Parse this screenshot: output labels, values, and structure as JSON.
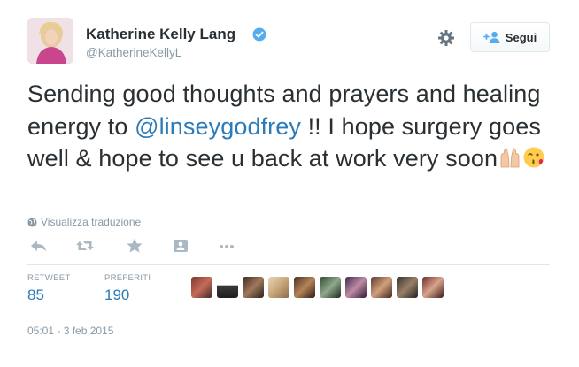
{
  "author": {
    "name": "Katherine Kelly Lang",
    "handle": "@KatherineKellyL",
    "verified": true
  },
  "header": {
    "follow_label": "Segui"
  },
  "tweet": {
    "text_before": "Sending good thoughts and prayers and healing energy to ",
    "mention": "@linseygodfrey",
    "text_after": " !! I hope surgery goes well & hope to see u back at work very soon",
    "emojis": [
      "raising-hands-emoji",
      "face-blowing-kiss-emoji"
    ]
  },
  "translate_label": "Visualizza traduzione",
  "actions": [
    "reply-icon",
    "retweet-icon",
    "favorite-icon",
    "follow-person-icon",
    "more-icon"
  ],
  "stats": {
    "retweets_label": "RETWEET",
    "retweets_value": "85",
    "favorites_label": "PREFERITI",
    "favorites_value": "190"
  },
  "timestamp": "05:01 - 3 feb 2015",
  "colors": {
    "link": "#2b7bb9",
    "muted": "#8899a6",
    "text": "#292f33",
    "border": "#e1e8ed",
    "verified": "#55acee"
  }
}
